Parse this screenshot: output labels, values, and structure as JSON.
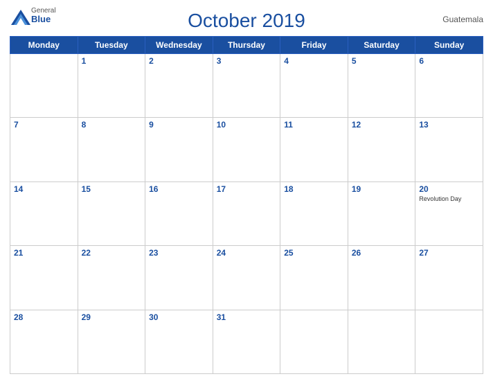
{
  "header": {
    "logo_general": "General",
    "logo_blue": "Blue",
    "title": "October 2019",
    "country": "Guatemala"
  },
  "days_of_week": [
    "Monday",
    "Tuesday",
    "Wednesday",
    "Thursday",
    "Friday",
    "Saturday",
    "Sunday"
  ],
  "weeks": [
    [
      {
        "day": "",
        "empty": true
      },
      {
        "day": "1"
      },
      {
        "day": "2"
      },
      {
        "day": "3"
      },
      {
        "day": "4"
      },
      {
        "day": "5"
      },
      {
        "day": "6"
      }
    ],
    [
      {
        "day": "7"
      },
      {
        "day": "8"
      },
      {
        "day": "9"
      },
      {
        "day": "10"
      },
      {
        "day": "11"
      },
      {
        "day": "12"
      },
      {
        "day": "13"
      }
    ],
    [
      {
        "day": "14"
      },
      {
        "day": "15"
      },
      {
        "day": "16"
      },
      {
        "day": "17"
      },
      {
        "day": "18"
      },
      {
        "day": "19"
      },
      {
        "day": "20",
        "holiday": "Revolution Day"
      }
    ],
    [
      {
        "day": "21"
      },
      {
        "day": "22"
      },
      {
        "day": "23"
      },
      {
        "day": "24"
      },
      {
        "day": "25"
      },
      {
        "day": "26"
      },
      {
        "day": "27"
      }
    ],
    [
      {
        "day": "28"
      },
      {
        "day": "29"
      },
      {
        "day": "30"
      },
      {
        "day": "31"
      },
      {
        "day": "",
        "empty": true
      },
      {
        "day": "",
        "empty": true
      },
      {
        "day": "",
        "empty": true
      }
    ]
  ]
}
